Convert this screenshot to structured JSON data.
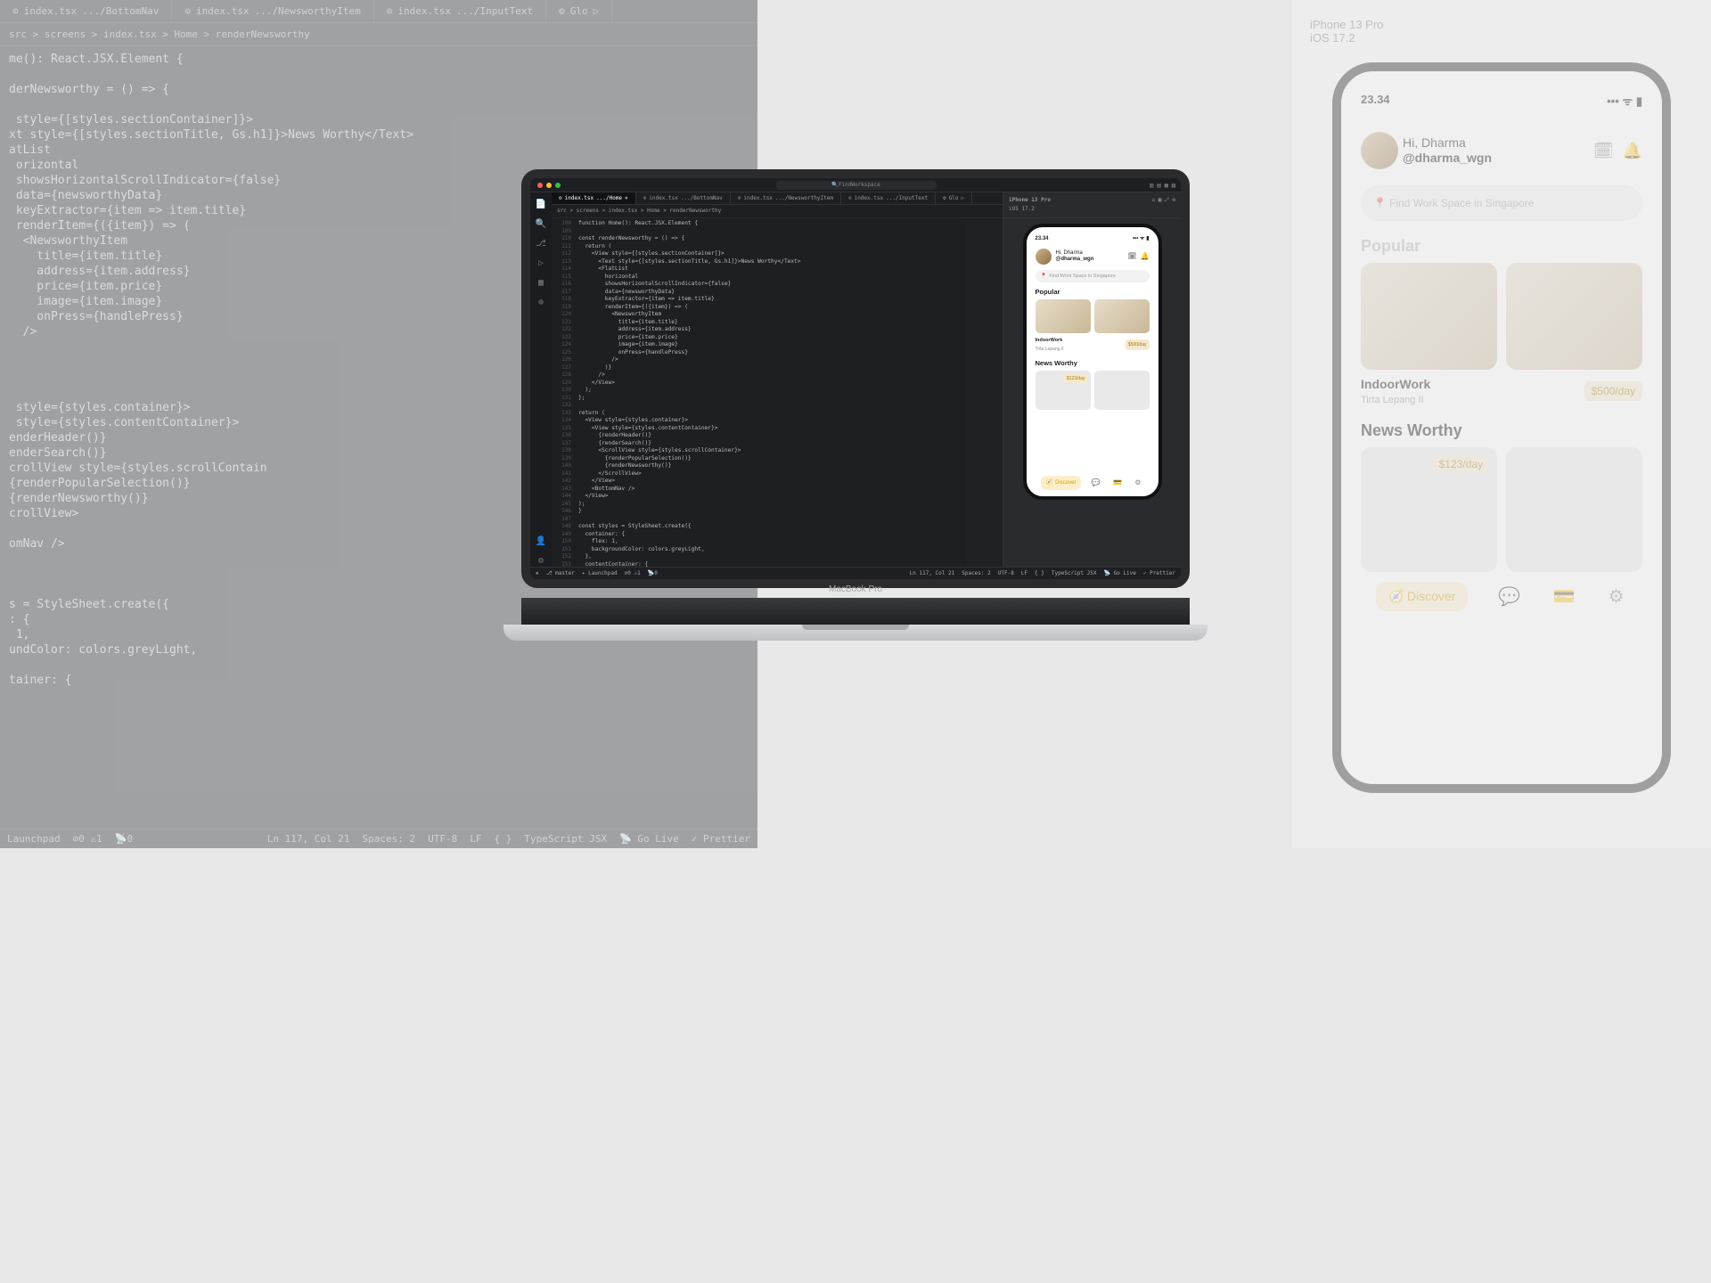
{
  "tabs": [
    {
      "file": "index.tsx",
      "path": ".../BottomNav",
      "active": false
    },
    {
      "file": "index.tsx",
      "path": ".../Home",
      "active": true
    },
    {
      "file": "index.tsx",
      "path": ".../NewsworthyItem",
      "active": false
    },
    {
      "file": "index.tsx",
      "path": ".../InputText",
      "active": false
    }
  ],
  "run_config": "Glo",
  "breadcrumb": "src > screens > index.tsx > Home > renderNewsworthy",
  "code_bg": "me(): React.JSX.Element {\n\nderNewsworthy = () => {\n\n style={[styles.sectionContainer]}>\nxt style={[styles.sectionTitle, Gs.h1]}>News Worthy</Text>\natList\n orizontal\n showsHorizontalScrollIndicator={false}\n data={newsworthyData}\n keyExtractor={item => item.title}\n renderItem={({item}) => (\n  <NewsworthyItem\n    title={item.title}\n    address={item.address}\n    price={item.price}\n    image={item.image}\n    onPress={handlePress}\n  />\n\n\n\n\n style={styles.container}>\n style={styles.contentContainer}>\nenderHeader()}\nenderSearch()}\ncrollView style={styles.scrollContain\n{renderPopularSelection()}\n{renderNewsworthy()}\ncrollView>\n\nomNav />\n\n\n\ns = StyleSheet.create({\n: {\n 1,\nundColor: colors.greyLight,\n\ntainer: {",
  "status": {
    "branch": "master",
    "launchpad": "Launchpad",
    "errors": "0",
    "warnings": "1",
    "ports": "0",
    "cursor": "Ln 117, Col 21",
    "spaces": "Spaces: 2",
    "encoding": "UTF-8",
    "eol": "LF",
    "lang": "TypeScript JSX",
    "golive": "Go Live",
    "prettier": "Prettier"
  },
  "laptop": {
    "label": "MacBook Pro",
    "titlebar_search": "FindWorkspace",
    "sim_device": "iPhone 13 Pro",
    "sim_os": "iOS 17.2",
    "code_lines_start": 108,
    "code": "function Home(): React.JSX.Element {\n\nconst renderNewsworthy = () => {\n  return (\n    <View style={[styles.sectionContainer]}>\n      <Text style={[styles.sectionTitle, Gs.h1]}>News Worthy</Text>\n      <FlatList\n        horizontal\n        showsHorizontalScrollIndicator={false}\n        data={newsworthyData}\n        keyExtractor={item => item.title}\n        renderItem={({item}) => (\n          <NewsworthyItem\n            title={item.title}\n            address={item.address}\n            price={item.price}\n            image={item.image}\n            onPress={handlePress}\n          />\n        )}\n      />\n    </View>\n  );\n};\n\nreturn (\n  <View style={styles.container}>\n    <View style={styles.contentContainer}>\n      {renderHeader()}\n      {renderSearch()}\n      <ScrollView style={styles.scrollContainer}>\n        {renderPopularSelection()}\n        {renderNewsworthy()}\n      </ScrollView>\n    </View>\n    <BottomNav />\n  </View>\n);\n}\n\nconst styles = StyleSheet.create({\n  container: {\n    flex: 1,\n    backgroundColor: colors.greyLight,\n  },\n  contentContainer: {"
  },
  "app": {
    "time": "23.34",
    "greeting_hi": "Hi, Dharma",
    "greeting_handle": "@dharma_wgn",
    "search_placeholder": "Find Work Space in Singapore",
    "popular_title": "Popular",
    "popular_item_title": "IndoorWork",
    "popular_item_subtitle": "Tirta Lepang II",
    "popular_price": "$500/day",
    "news_title": "News Worthy",
    "news_price": "$123/day",
    "nav_discover": "Discover"
  }
}
